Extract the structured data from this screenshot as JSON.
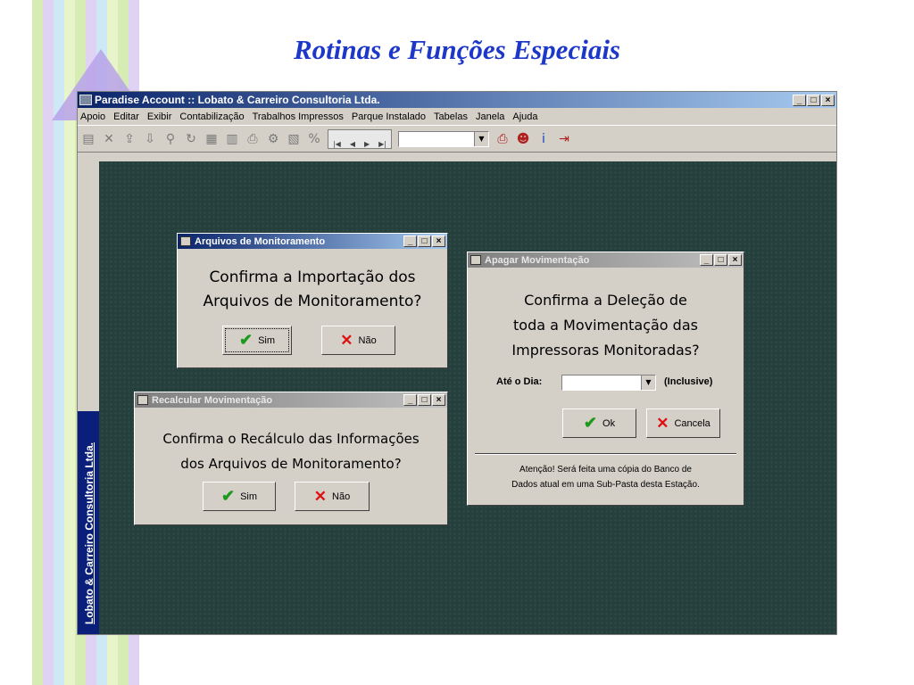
{
  "slide_title": "Rotinas e Funções Especiais",
  "app": {
    "title": "Paradise Account :: Lobato & Carreiro Consultoria Ltda.",
    "window_buttons": [
      "_",
      "□",
      "×"
    ],
    "menu": [
      "Apoio",
      "Editar",
      "Exibir",
      "Contabilização",
      "Trabalhos Impressos",
      "Parque Instalado",
      "Tabelas",
      "Janela",
      "Ajuda"
    ],
    "toolbar_icons": [
      "save-icon",
      "delete-icon",
      "export-icon",
      "import-icon",
      "find-icon",
      "refresh-icon",
      "grid-icon",
      "calc-icon",
      "print-icon",
      "settings-icon",
      "chart-icon",
      "percent-icon",
      "nav-icon",
      "combo-icon",
      "printer-icon",
      "user-icon",
      "info-icon",
      "exit-icon"
    ],
    "side_label": "Lobato & Carreiro Consultoria Ltda."
  },
  "dialog_arquivos": {
    "title": "Arquivos de Monitoramento",
    "line1": "Confirma a Importação dos",
    "line2": "Arquivos de Monitoramento?",
    "yes": "Sim",
    "no": "Não"
  },
  "dialog_recalcular": {
    "title": "Recalcular Movimentação",
    "line1": "Confirma o Recálculo das Informações",
    "line2": "dos Arquivos de Monitoramento?",
    "yes": "Sim",
    "no": "Não"
  },
  "dialog_apagar": {
    "title": "Apagar Movimentação",
    "line1": "Confirma a Deleção de",
    "line2": "toda a Movimentação das",
    "line3": "Impressoras Monitoradas?",
    "date_label": "Até o Dia:",
    "date_value": "",
    "inclusive": "(Inclusive)",
    "ok": "Ok",
    "cancel": "Cancela",
    "note1": "Atenção! Será feita uma cópia do Banco de",
    "note2": "Dados atual em uma Sub-Pasta desta Estação."
  }
}
